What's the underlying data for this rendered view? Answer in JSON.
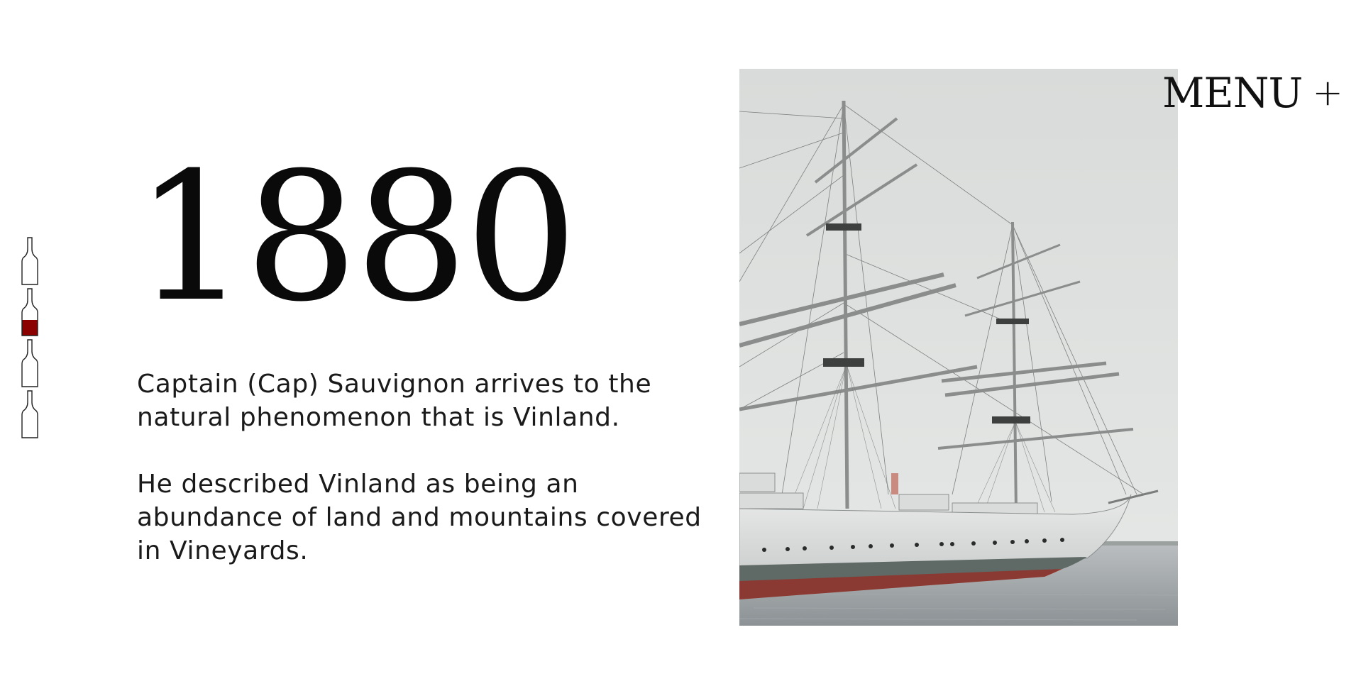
{
  "nav": {
    "bottles": [
      {
        "label": "bottle-1",
        "active": false
      },
      {
        "label": "bottle-2",
        "active": true
      },
      {
        "label": "bottle-3",
        "active": false
      },
      {
        "label": "bottle-4",
        "active": false
      }
    ],
    "active_fill_color": "#8b0000"
  },
  "menu": {
    "label": "MENU",
    "plus": "+"
  },
  "hero": {
    "year": "1880",
    "paragraphs": [
      "Captain (Cap) Sauvignon arrives to the natural phenomenon that is Vinland.",
      "He described Vinland as being an abundance of land and mountains covered in Vineyards."
    ]
  },
  "photo": {
    "subject": "tall-ship-photo"
  }
}
